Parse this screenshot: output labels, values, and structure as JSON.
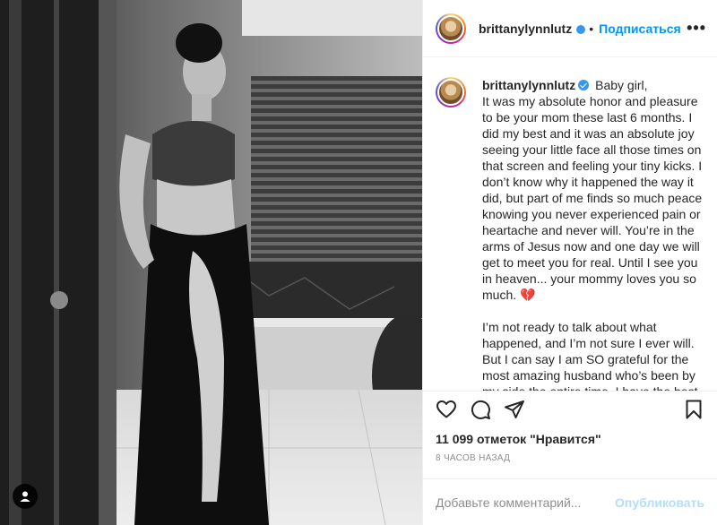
{
  "header": {
    "username": "brittanylynnlutz",
    "separator": "•",
    "follow_label": "Подписаться",
    "more_label": "•••"
  },
  "caption": {
    "username": "brittanylynnlutz",
    "text": "Baby girl,\nIt was my absolute honor and pleasure to be your mom these last 6 months. I did my best and it was an absolute joy seeing your little face all those times on that screen and feeling your tiny kicks. I don’t know why it happened the way it did, but part of me finds so much peace knowing you never experienced pain or heartache and never will. You’re in the arms of Jesus now and one day we will get to meet you for real. Until I see you in heaven... your mommy loves you so much. 💔\n\nI’m not ready to talk about what happened, and I’m not sure I ever will. But I can say I am SO grateful for the most amazing husband who’s been by my side the entire time. I have the best"
  },
  "actions": {
    "like_icon": "heart-icon",
    "comment_icon": "comment-icon",
    "share_icon": "share-icon",
    "save_icon": "bookmark-icon"
  },
  "likes": "11 099 отметок \"Нравится\"",
  "timestamp": "8 ЧАСОВ НАЗАД",
  "comment_box": {
    "placeholder": "Добавьте комментарий...",
    "post_label": "Опубликовать"
  },
  "colors": {
    "accent": "#0095f6",
    "post_disabled": "#b2dffc",
    "muted": "#8e8e8e"
  }
}
